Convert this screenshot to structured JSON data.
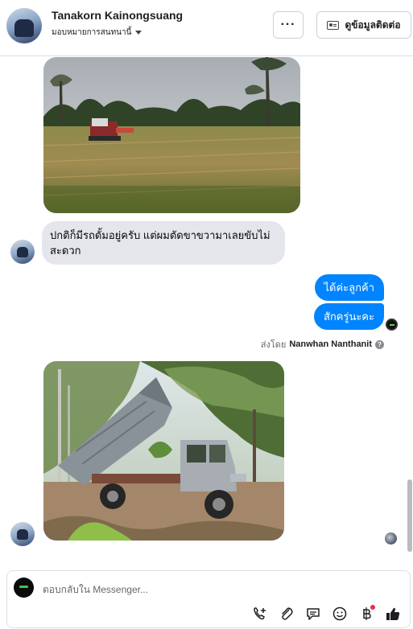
{
  "header": {
    "name": "Tanakorn Kainongsuang",
    "assignment": "มอบหมายการสนทนานี้",
    "more_button": "···",
    "contact_button": "ดูข้อมูลติดต่อ",
    "icons": {
      "more": "more-dots-icon",
      "contact": "contact-card-icon",
      "assign": "caret-down-icon"
    }
  },
  "thread": {
    "incoming_message": "ปกติก็มีรถดั้มอยู่ครับ แต่ผมตัดขาขวามาเลยขับไม่สะดวก",
    "outgoing_messages": [
      "ได้ค่ะลูกค้า",
      "สักครู่นะคะ"
    ],
    "sent_by_prefix": "ส่งโดย",
    "sent_by_name": "Nanwhan Nanthanit",
    "info_icon": "?",
    "colors": {
      "outgoing_bubble": "#0084ff",
      "incoming_bubble": "#e4e6eb"
    }
  },
  "composer": {
    "placeholder": "ตอบกลับใน Messenger...",
    "tools": [
      "add-call-icon",
      "attachment-icon",
      "saved-reply-icon",
      "emoji-icon",
      "baht-payment-icon",
      "thumbs-up-icon"
    ],
    "accent_color": "#1c1e21"
  }
}
